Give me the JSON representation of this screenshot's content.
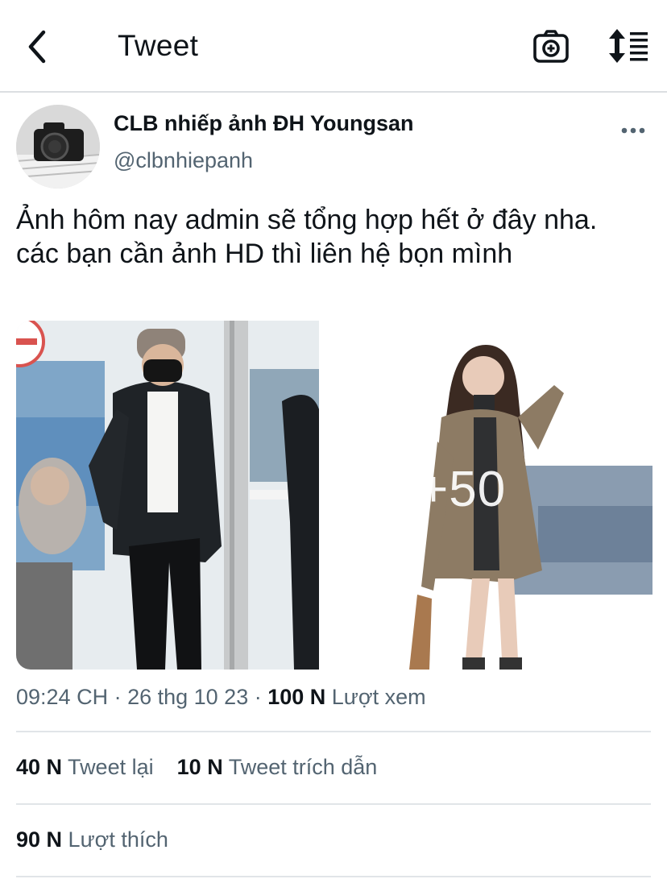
{
  "header": {
    "title": "Tweet",
    "back_icon": "back-arrow-icon",
    "camera_icon": "camera-add-icon",
    "sort_icon": "sort-list-icon"
  },
  "tweet": {
    "author_name": "CLB nhiếp ảnh ĐH Youngsan",
    "handle": "@clbnhiepanh",
    "text_line1": "Ảnh hôm nay admin sẽ tổng hợp hết ở đây nha.",
    "text_line2": "các bạn cần ảnh HD thì liên hệ bọn mình",
    "more_photos": "+50"
  },
  "meta": {
    "time": "09:24 CH",
    "sep1": " · ",
    "date": "26 thg 10 23",
    "sep2": " · ",
    "views_count": "100 N",
    "views_label": " Lượt xem"
  },
  "stats": {
    "retweets_count": "40 N",
    "retweets_label": " Tweet lại",
    "quotes_count": "10 N",
    "quotes_label": " Tweet trích dẫn",
    "likes_count": "90 N",
    "likes_label": " Lượt thích"
  }
}
